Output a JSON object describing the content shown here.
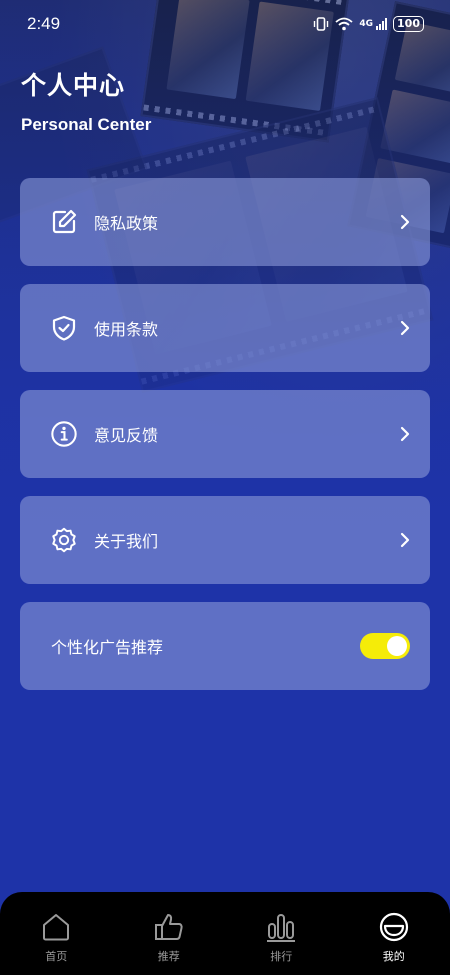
{
  "status_bar": {
    "time": "2:49",
    "network": "4G",
    "battery": "100"
  },
  "header": {
    "title": "个人中心",
    "subtitle": "Personal Center"
  },
  "menu": {
    "items": [
      {
        "label": "隐私政策",
        "icon": "edit-icon"
      },
      {
        "label": "使用条款",
        "icon": "shield-check-icon"
      },
      {
        "label": "意见反馈",
        "icon": "info-icon"
      },
      {
        "label": "关于我们",
        "icon": "gear-icon"
      }
    ],
    "ad_toggle": {
      "label": "个性化广告推荐",
      "enabled": true
    }
  },
  "tabbar": {
    "tabs": [
      {
        "label": "首页",
        "icon": "home-icon",
        "active": false
      },
      {
        "label": "推荐",
        "icon": "thumbs-up-icon",
        "active": false
      },
      {
        "label": "排行",
        "icon": "bar-chart-icon",
        "active": false
      },
      {
        "label": "我的",
        "icon": "smiley-icon",
        "active": true
      }
    ]
  },
  "colors": {
    "background": "#1e33a8",
    "card": "#8896d7",
    "toggle_on": "#f5ec08",
    "tabbar": "#000000"
  }
}
